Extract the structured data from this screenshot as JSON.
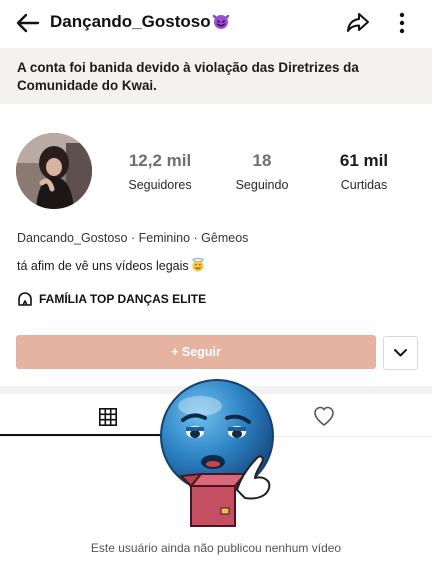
{
  "header": {
    "title": "Dançando_Gostoso",
    "title_emoji": "smiling-devil-emoji"
  },
  "ban_notice": "A conta foi banida devido à violação das Diretrizes da Comunidade do Kwai.",
  "stats": [
    {
      "value": "12,2 mil",
      "label": "Seguidores"
    },
    {
      "value": "18",
      "label": "Seguindo"
    },
    {
      "value": "61 mil",
      "label": "Curtidas"
    }
  ],
  "profile": {
    "username": "Dancando_Gostoso",
    "gender": "Feminino",
    "sign": "Gêmeos",
    "bio": "tá afim de vê uns vídeos legais",
    "family": "FAMÍLIA TOP DANÇAS ELITE"
  },
  "actions": {
    "follow_label": "+ Seguir"
  },
  "empty_state": "Este usuário ainda não publicou nenhum vídeo",
  "colors": {
    "follow_bg": "#e6b3a0",
    "ban_bg": "#f4f1f1",
    "emoji_blue": "#2f86c6"
  }
}
